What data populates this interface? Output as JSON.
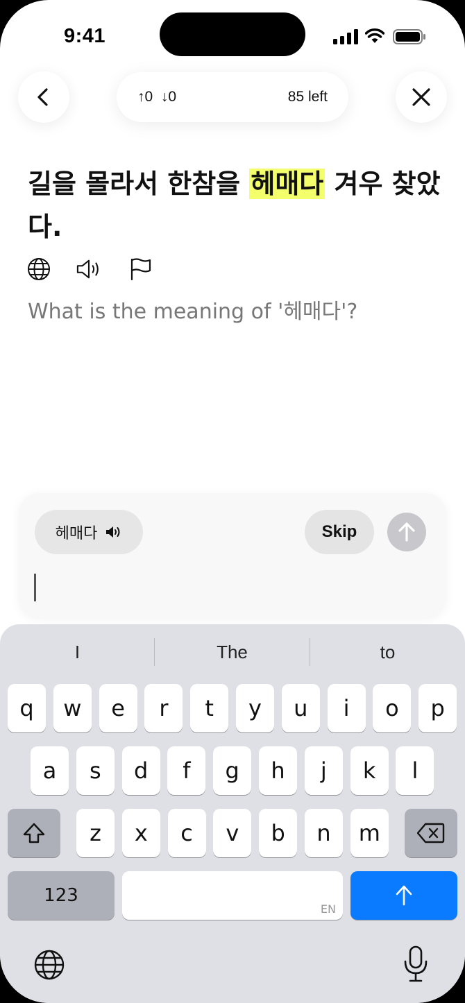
{
  "status_bar": {
    "time": "9:41"
  },
  "header": {
    "up_count": "↑0",
    "down_count": "↓0",
    "remaining": "85 left"
  },
  "question": {
    "sentence_before": "길을 몰라서 한참을 ",
    "highlight": "헤매다",
    "sentence_after": " 겨우 찾았다.",
    "prompt": "What is the meaning of '헤매다'?"
  },
  "answer": {
    "word_chip": "헤매다",
    "skip_label": "Skip",
    "input_value": ""
  },
  "keyboard": {
    "suggestions": [
      "I",
      "The",
      "to"
    ],
    "row1": [
      "q",
      "w",
      "e",
      "r",
      "t",
      "y",
      "u",
      "i",
      "o",
      "p"
    ],
    "row2": [
      "a",
      "s",
      "d",
      "f",
      "g",
      "h",
      "j",
      "k",
      "l"
    ],
    "row3": [
      "z",
      "x",
      "c",
      "v",
      "b",
      "n",
      "m"
    ],
    "numbers_label": "123",
    "space_lang": "EN"
  },
  "colors": {
    "highlight": "#f3ff6b",
    "return_key": "#0a7bff",
    "send_disabled": "#c7c7cc"
  }
}
